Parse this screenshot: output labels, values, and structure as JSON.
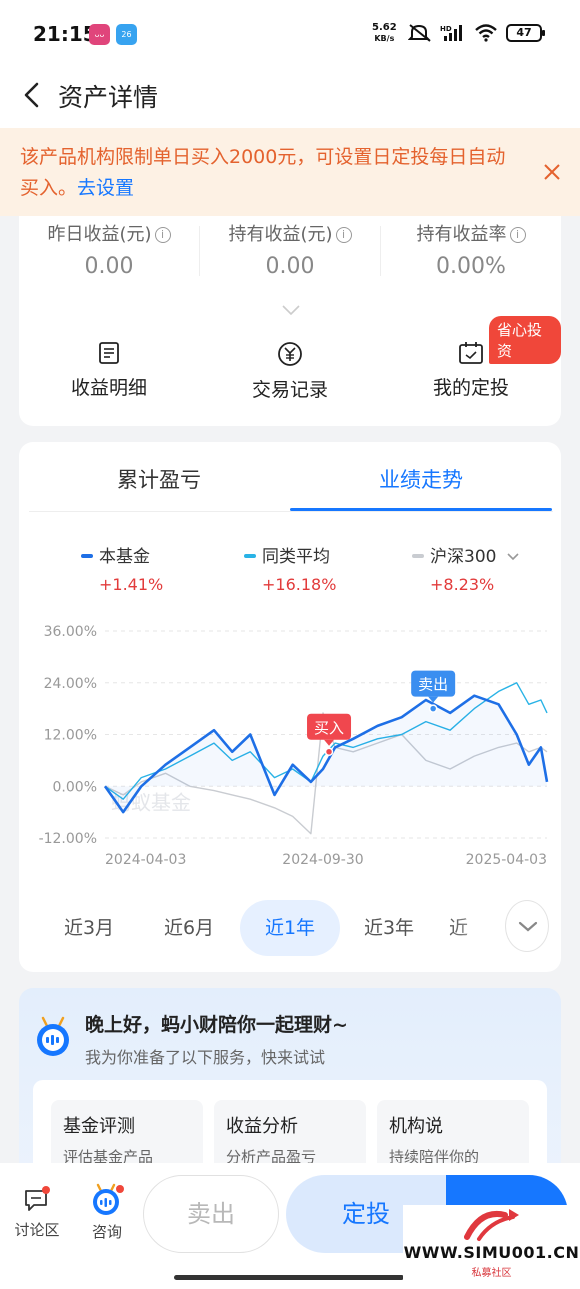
{
  "status_bar": {
    "time": "21:15",
    "app1_label": "ᴗᴗ",
    "app2_label": "26",
    "net_speed_value": "5.62",
    "net_speed_unit": "KB/s",
    "battery": "47"
  },
  "nav": {
    "title": "资产详情"
  },
  "notice": {
    "text": "该产品机构限制单日买入2000元，可设置日定投每日自动买入。",
    "link": "去设置"
  },
  "metrics": [
    {
      "label": "昨日收益(元)",
      "value": "0.00"
    },
    {
      "label": "持有收益(元)",
      "value": "0.00"
    },
    {
      "label": "持有收益率",
      "value": "0.00%"
    }
  ],
  "actions": [
    {
      "label": "收益明细",
      "icon": "document-icon"
    },
    {
      "label": "交易记录",
      "icon": "yen-coin-icon"
    },
    {
      "label": "我的定投",
      "icon": "calendar-icon"
    }
  ],
  "save_badge": "省心投资",
  "tabs": {
    "left": "累计盈亏",
    "right": "业绩走势",
    "active": "right"
  },
  "legend": [
    {
      "name": "本基金",
      "value": "+1.41%",
      "color": "#1e6fe6"
    },
    {
      "name": "同类平均",
      "value": "+16.18%",
      "color": "#29b3e6"
    },
    {
      "name": "沪深300",
      "value": "+8.23%",
      "color": "#c9ccd1"
    }
  ],
  "chart_data": {
    "type": "line",
    "watermark": "蚂蚁基金",
    "y_ticks": [
      "36.00%",
      "24.00%",
      "12.00%",
      "0.00%",
      "-12.00%"
    ],
    "x_ticks": [
      "2024-04-03",
      "2024-09-30",
      "2025-04-03"
    ],
    "ylim": [
      -12,
      36
    ],
    "markers": [
      {
        "label": "买入",
        "x": "2024-10-05",
        "y": 8,
        "color": "#f0474e"
      },
      {
        "label": "卖出",
        "x": "2024-12-30",
        "y": 18,
        "color": "#3a8ef0"
      }
    ],
    "series": [
      {
        "name": "本基金",
        "color": "#1e6fe6",
        "points": [
          [
            "2024-04-03",
            0
          ],
          [
            "2024-04-18",
            -6
          ],
          [
            "2024-05-03",
            0
          ],
          [
            "2024-05-23",
            5
          ],
          [
            "2024-06-12",
            9
          ],
          [
            "2024-07-02",
            13
          ],
          [
            "2024-07-17",
            8
          ],
          [
            "2024-08-01",
            12
          ],
          [
            "2024-08-21",
            -2
          ],
          [
            "2024-09-05",
            5
          ],
          [
            "2024-09-20",
            1
          ],
          [
            "2024-09-30",
            4
          ],
          [
            "2024-10-10",
            9
          ],
          [
            "2024-10-25",
            11
          ],
          [
            "2024-11-14",
            14
          ],
          [
            "2024-12-04",
            16
          ],
          [
            "2024-12-24",
            20
          ],
          [
            "2025-01-13",
            17
          ],
          [
            "2025-02-02",
            21
          ],
          [
            "2025-02-22",
            19
          ],
          [
            "2025-03-09",
            12
          ],
          [
            "2025-03-19",
            5
          ],
          [
            "2025-03-29",
            9
          ],
          [
            "2025-04-03",
            1
          ]
        ]
      },
      {
        "name": "同类平均",
        "color": "#29b3e6",
        "points": [
          [
            "2024-04-03",
            0
          ],
          [
            "2024-04-18",
            -3
          ],
          [
            "2024-05-03",
            2
          ],
          [
            "2024-05-23",
            4
          ],
          [
            "2024-06-12",
            7
          ],
          [
            "2024-07-02",
            10
          ],
          [
            "2024-07-17",
            6
          ],
          [
            "2024-08-01",
            8
          ],
          [
            "2024-08-21",
            2
          ],
          [
            "2024-09-05",
            4
          ],
          [
            "2024-09-20",
            1
          ],
          [
            "2024-09-30",
            7
          ],
          [
            "2024-10-10",
            10
          ],
          [
            "2024-10-25",
            9
          ],
          [
            "2024-11-14",
            11
          ],
          [
            "2024-12-04",
            12
          ],
          [
            "2024-12-24",
            15
          ],
          [
            "2025-01-13",
            13
          ],
          [
            "2025-02-02",
            18
          ],
          [
            "2025-02-22",
            22
          ],
          [
            "2025-03-09",
            24
          ],
          [
            "2025-03-19",
            19
          ],
          [
            "2025-03-29",
            20
          ],
          [
            "2025-04-03",
            17
          ]
        ]
      },
      {
        "name": "沪深300",
        "color": "#c9ccd1",
        "points": [
          [
            "2024-04-03",
            0
          ],
          [
            "2024-04-18",
            -2
          ],
          [
            "2024-05-03",
            1
          ],
          [
            "2024-05-23",
            3
          ],
          [
            "2024-06-12",
            0
          ],
          [
            "2024-07-02",
            -1
          ],
          [
            "2024-07-17",
            -2
          ],
          [
            "2024-08-01",
            -3
          ],
          [
            "2024-08-21",
            -5
          ],
          [
            "2024-09-05",
            -7
          ],
          [
            "2024-09-20",
            -11
          ],
          [
            "2024-09-30",
            17
          ],
          [
            "2024-10-10",
            9
          ],
          [
            "2024-10-25",
            8
          ],
          [
            "2024-11-14",
            10
          ],
          [
            "2024-12-04",
            12
          ],
          [
            "2024-12-24",
            6
          ],
          [
            "2025-01-13",
            4
          ],
          [
            "2025-02-02",
            7
          ],
          [
            "2025-02-22",
            9
          ],
          [
            "2025-03-09",
            10
          ],
          [
            "2025-03-19",
            8
          ],
          [
            "2025-03-29",
            9
          ],
          [
            "2025-04-03",
            8
          ]
        ]
      }
    ]
  },
  "ranges": {
    "items": [
      "近3月",
      "近6月",
      "近1年",
      "近3年",
      "近"
    ],
    "active": 2
  },
  "assistant": {
    "greeting": "晚上好，蚂小财陪你一起理财~",
    "sub": "我为你准备了以下服务，快来试试",
    "services": [
      {
        "title": "基金评测",
        "desc": "评估基金产品"
      },
      {
        "title": "收益分析",
        "desc": "分析产品盈亏"
      },
      {
        "title": "机构说",
        "desc": "持续陪伴你的"
      }
    ]
  },
  "bottom": {
    "discuss": "讨论区",
    "consult": "咨询",
    "sell": "卖出",
    "sip": "定投"
  },
  "watermark": {
    "url": "WWW.SIMU001.CN",
    "sub": "私募社区"
  }
}
